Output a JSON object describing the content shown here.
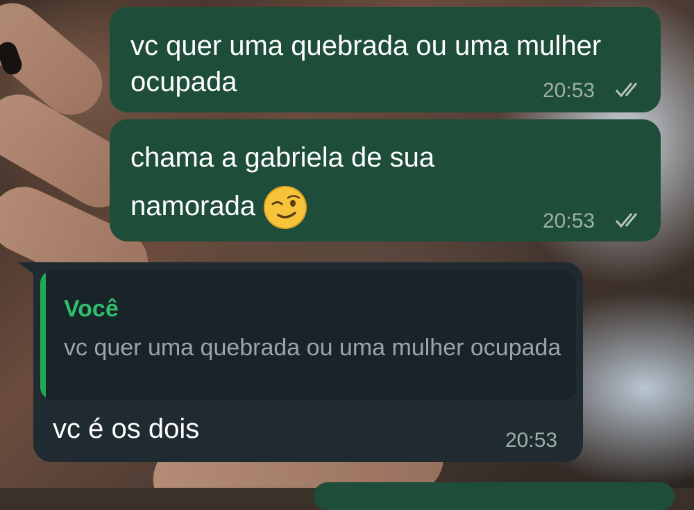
{
  "messages": [
    {
      "direction": "outgoing",
      "text": "vc quer uma quebrada ou uma mulher ocupada",
      "time": "20:53",
      "status": "read-double-check-icon"
    },
    {
      "direction": "outgoing",
      "text": "chama a gabriela de sua namorada",
      "emoji": "winking-face-emoji",
      "time": "20:53",
      "status": "read-double-check-icon"
    },
    {
      "direction": "incoming",
      "reply_to": {
        "author": "Você",
        "text": "vc quer uma quebrada ou uma mulher ocupada"
      },
      "text": "vc é os dois",
      "time": "20:53"
    }
  ],
  "colors": {
    "outgoing_bubble": "#1e4d3a",
    "incoming_bubble": "#1f2a31",
    "quote_accent": "#1fa855",
    "quote_author": "#2fbf6c"
  }
}
